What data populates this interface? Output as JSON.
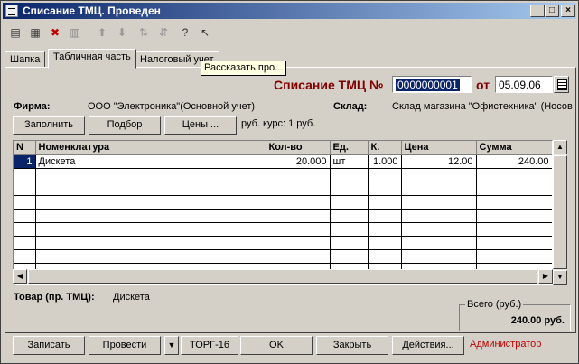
{
  "window": {
    "title": "Списание ТМЦ. Проведен",
    "controls": [
      "_",
      "□",
      "×"
    ]
  },
  "toolbar": {
    "icons": [
      "new-row-icon",
      "copy-row-icon",
      "delete-row-icon",
      "edit-row-icon",
      "move-up-icon",
      "move-down-icon",
      "sort-asc-icon",
      "sort-desc-icon",
      "help-icon",
      "context-help-icon"
    ]
  },
  "tabs": [
    "Шапка",
    "Табличная часть",
    "Налоговый учет"
  ],
  "tooltip": "Рассказать про...",
  "header": {
    "doc_label": "Списание ТМЦ №",
    "doc_number": "0000000001",
    "date_label": "от",
    "date_value": "05.09.06",
    "firm_label": "Фирма:",
    "firm_value": "ООО \"Электроника\"(Основной учет)",
    "warehouse_label": "Склад:",
    "warehouse_value": "Склад магазина \"Офистехника\" (Носов"
  },
  "actions": {
    "fill": "Заполнить",
    "select": "Подбор",
    "prices": "Цены ...",
    "rate": "руб. курс: 1 руб."
  },
  "table": {
    "columns": [
      "N",
      "Номенклатура",
      "Кол-во",
      "Ед.",
      "К.",
      "Цена",
      "Сумма"
    ],
    "rows": [
      [
        "1",
        "Дискета",
        "20.000",
        "шт",
        "1.000",
        "12.00",
        "240.00"
      ]
    ]
  },
  "footer": {
    "item_label": "Товар (пр. ТМЦ):",
    "item_value": "Дискета",
    "total_label": "Всего (руб.)",
    "total_value": "240.00 руб."
  },
  "buttons": {
    "save": "Записать",
    "post": "Провести",
    "dropdown": "▼",
    "torg": "ТОРГ-16",
    "ok": "OK",
    "close": "Закрыть",
    "actions": "Действия...",
    "user": "Администратор"
  },
  "colors": {
    "title_bar": "#0a246a",
    "doc_title": "#800000",
    "user": "#c00000"
  }
}
